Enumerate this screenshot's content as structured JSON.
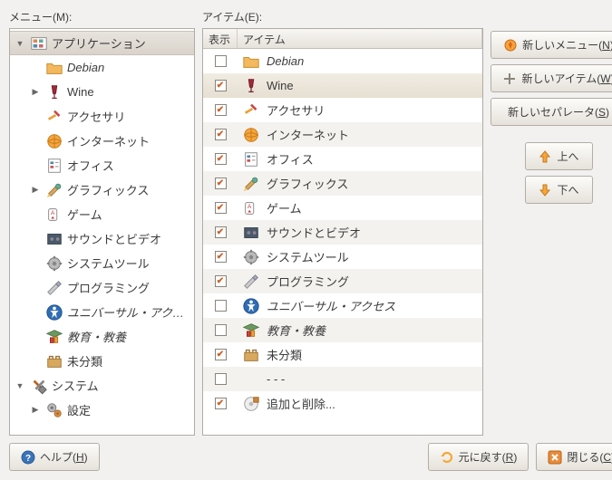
{
  "labels": {
    "menu": "メニュー(M):",
    "items": "アイテム(E):"
  },
  "columns": {
    "show": "表示",
    "item": "アイテム"
  },
  "tree": [
    {
      "level": 0,
      "expander": "down",
      "icon": "applications",
      "label": "アプリケーション",
      "selected": true
    },
    {
      "level": 1,
      "expander": null,
      "icon": "folder",
      "label": "Debian",
      "italic": true
    },
    {
      "level": 1,
      "expander": "right",
      "icon": "wine",
      "label": "Wine"
    },
    {
      "level": 1,
      "expander": null,
      "icon": "accessories",
      "label": "アクセサリ"
    },
    {
      "level": 1,
      "expander": null,
      "icon": "internet",
      "label": "インターネット"
    },
    {
      "level": 1,
      "expander": null,
      "icon": "office",
      "label": "オフィス"
    },
    {
      "level": 1,
      "expander": "right",
      "icon": "graphics",
      "label": "グラフィックス"
    },
    {
      "level": 1,
      "expander": null,
      "icon": "games",
      "label": "ゲーム"
    },
    {
      "level": 1,
      "expander": null,
      "icon": "multimedia",
      "label": "サウンドとビデオ"
    },
    {
      "level": 1,
      "expander": null,
      "icon": "system-tools",
      "label": "システムツール"
    },
    {
      "level": 1,
      "expander": null,
      "icon": "development",
      "label": "プログラミング"
    },
    {
      "level": 1,
      "expander": null,
      "icon": "accessibility",
      "label": "ユニバーサル・アクセス",
      "italic": true
    },
    {
      "level": 1,
      "expander": null,
      "icon": "education",
      "label": "教育・教養",
      "italic": true
    },
    {
      "level": 1,
      "expander": null,
      "icon": "other",
      "label": "未分類"
    },
    {
      "level": 0,
      "expander": "down",
      "icon": "system",
      "label": "システム"
    },
    {
      "level": 1,
      "expander": "right",
      "icon": "preferences",
      "label": "設定"
    }
  ],
  "table": [
    {
      "checked": false,
      "icon": "folder",
      "label": "Debian",
      "italic": true
    },
    {
      "checked": true,
      "icon": "wine",
      "label": "Wine",
      "selected": true
    },
    {
      "checked": true,
      "icon": "accessories",
      "label": "アクセサリ"
    },
    {
      "checked": true,
      "icon": "internet",
      "label": "インターネット"
    },
    {
      "checked": true,
      "icon": "office",
      "label": "オフィス"
    },
    {
      "checked": true,
      "icon": "graphics",
      "label": "グラフィックス"
    },
    {
      "checked": true,
      "icon": "games",
      "label": "ゲーム"
    },
    {
      "checked": true,
      "icon": "multimedia",
      "label": "サウンドとビデオ"
    },
    {
      "checked": true,
      "icon": "system-tools",
      "label": "システムツール"
    },
    {
      "checked": true,
      "icon": "development",
      "label": "プログラミング"
    },
    {
      "checked": false,
      "icon": "accessibility",
      "label": "ユニバーサル・アクセス",
      "italic": true
    },
    {
      "checked": false,
      "icon": "education",
      "label": "教育・教養",
      "italic": true
    },
    {
      "checked": true,
      "icon": "other",
      "label": "未分類"
    },
    {
      "checked": false,
      "icon": null,
      "label": "- - -"
    },
    {
      "checked": true,
      "icon": "add-remove",
      "label": "追加と削除..."
    }
  ],
  "buttons": {
    "new_menu": {
      "text": "新しいメニュー(",
      "accel": "N",
      "suffix": ")"
    },
    "new_item": {
      "text": "新しいアイテム(",
      "accel": "W",
      "suffix": ")"
    },
    "new_separator": {
      "text": "新しいセパレータ(",
      "accel": "S",
      "suffix": ")"
    },
    "up": "上へ",
    "down": "下へ",
    "help": {
      "text": "ヘルプ(",
      "accel": "H",
      "suffix": ")"
    },
    "revert": {
      "text": "元に戻す(",
      "accel": "R",
      "suffix": ")"
    },
    "close": {
      "text": "閉じる(",
      "accel": "C",
      "suffix": ")"
    }
  }
}
